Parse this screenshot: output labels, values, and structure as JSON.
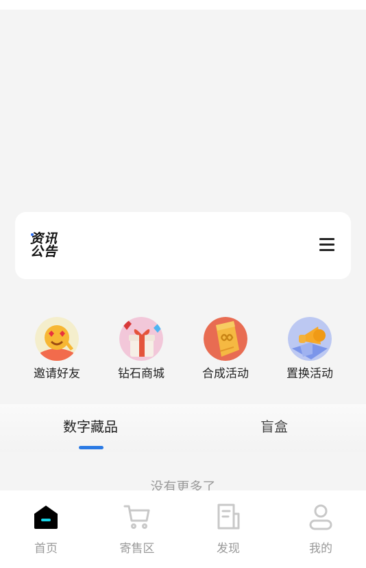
{
  "notice": {
    "logo_line1": "资讯",
    "logo_line2": "公告"
  },
  "quick_actions": [
    {
      "label": "邀请好友",
      "icon": "invite-friends-icon"
    },
    {
      "label": "钻石商城",
      "icon": "diamond-mall-icon"
    },
    {
      "label": "合成活动",
      "icon": "synthesis-activity-icon"
    },
    {
      "label": "置换活动",
      "icon": "exchange-activity-icon"
    }
  ],
  "tabs": [
    {
      "label": "数字藏品",
      "active": true
    },
    {
      "label": "盲盒",
      "active": false
    }
  ],
  "empty_text": "没有更多了",
  "bottom_nav": [
    {
      "label": "首页",
      "icon": "home-icon",
      "active": true
    },
    {
      "label": "寄售区",
      "icon": "cart-icon",
      "active": false
    },
    {
      "label": "发现",
      "icon": "discover-icon",
      "active": false
    },
    {
      "label": "我的",
      "icon": "profile-icon",
      "active": false
    }
  ],
  "colors": {
    "accent": "#2b7ae4",
    "background": "#f4f4f4",
    "active_icon_cyan": "#19d3e6"
  }
}
